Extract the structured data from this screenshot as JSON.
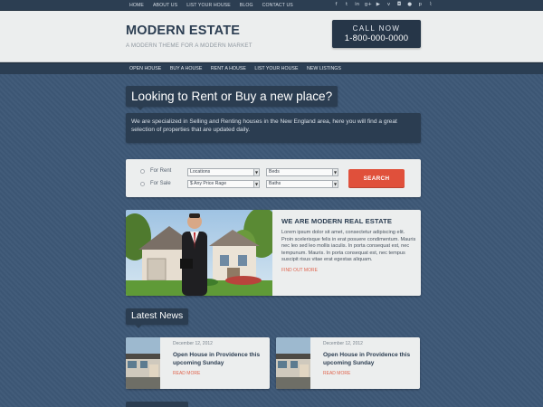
{
  "topbar": {
    "nav": [
      "HOME",
      "ABOUT US",
      "LIST YOUR HOUSE",
      "BLOG",
      "CONTACT US"
    ],
    "social_icons": [
      "facebook-icon",
      "twitter-icon",
      "linkedin-icon",
      "googleplus-icon",
      "youtube-icon",
      "vimeo-icon",
      "instagram-icon",
      "flickr-icon",
      "pinterest-icon",
      "rss-icon"
    ],
    "social_glyphs": [
      "f",
      "t",
      "in",
      "g+",
      "▶",
      "v",
      "◘",
      "●",
      "p",
      "⌇"
    ]
  },
  "header": {
    "logo": "MODERN ESTATE",
    "tagline": "A MODERN THEME FOR A MODERN MARKET",
    "call_label": "CALL NOW",
    "phone": "1-800-000-0000"
  },
  "mainnav": [
    "OPEN HOUSE",
    "BUY A HOUSE",
    "RENT A HOUSE",
    "LIST YOUR HOUSE",
    "NEW LISTINGS"
  ],
  "hero": {
    "title": "Looking to Rent or Buy a new place?",
    "text": "We are specialized in Selling and Renting houses in the New England area, here you will find a great selection of properties that are updated daily."
  },
  "search": {
    "options": [
      "For Rent",
      "For Sale"
    ],
    "locations": "Locations",
    "price": "$ Any Price Rage",
    "beds": "Beds",
    "baths": "Baths",
    "button": "SEARCH"
  },
  "feature": {
    "title": "WE ARE MODERN REAL ESTATE",
    "text": "Lorem ipsum dolor sit amet, consectetur adipiscing elit. Proin scelerisque felis in erat posuere condimentum. Mauris nec leo sed leo mollis iaculis. In porta consequat est, nec tempunum. Mauris. In porta consequat est, nec tempus suscipit risus vitae erat egestas aliquam.",
    "more": "FIND OUT MORE"
  },
  "news": {
    "title": "Latest News",
    "items": [
      {
        "date": "December 12, 2012",
        "title": "Open House in Providence this upcoming Sunday",
        "more": "READ MORE"
      },
      {
        "date": "December 12, 2012",
        "title": "Open House in Providence this upcoming Sunday",
        "more": "READ MORE"
      }
    ]
  }
}
